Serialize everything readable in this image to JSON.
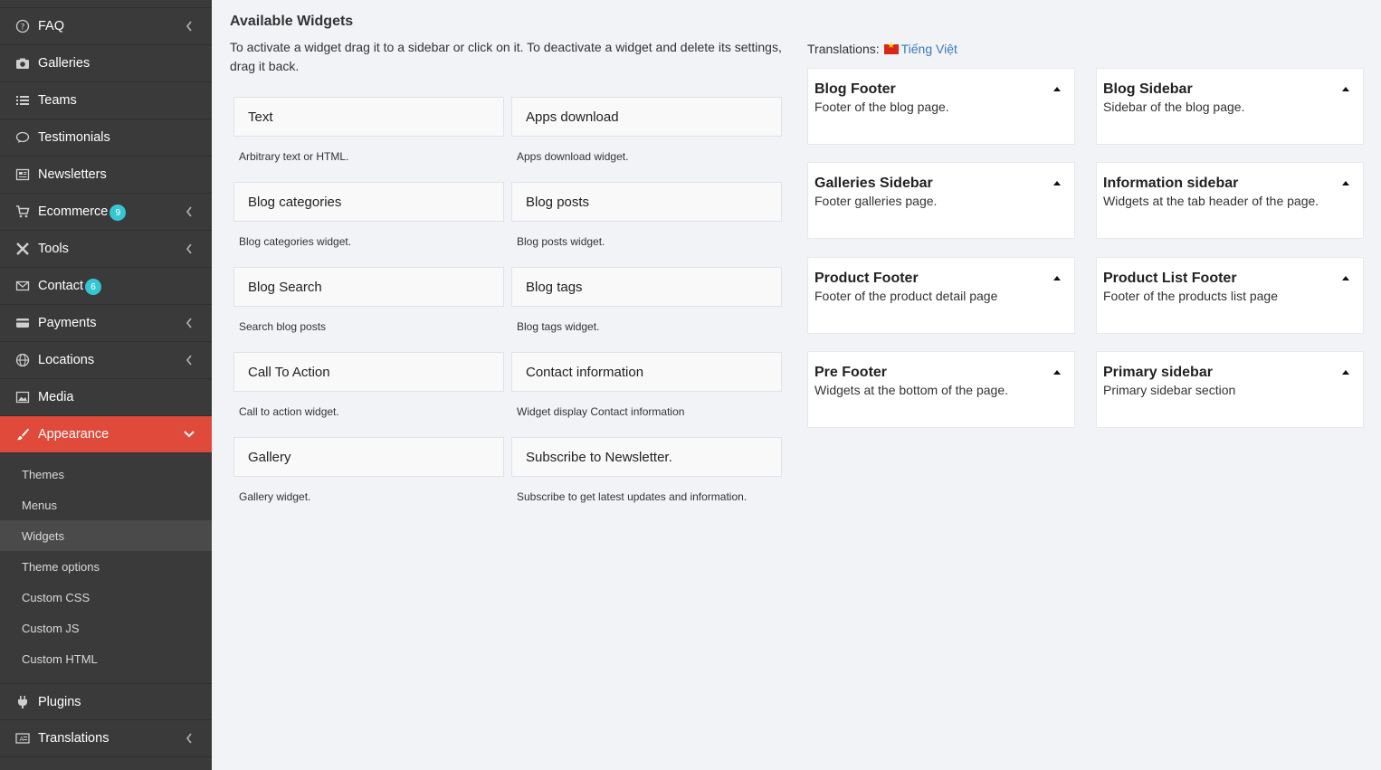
{
  "menu": {
    "top": [
      {
        "label": "FAQ",
        "icon": "question-circle-icon",
        "chevron": true
      },
      {
        "label": "Galleries",
        "icon": "camera-icon"
      },
      {
        "label": "Teams",
        "icon": "list-icon"
      },
      {
        "label": "Testimonials",
        "icon": "comment-icon"
      },
      {
        "label": "Newsletters",
        "icon": "newspaper-icon"
      },
      {
        "label": "Ecommerce",
        "icon": "cart-icon",
        "badge": "9",
        "chevron": true
      },
      {
        "label": "Tools",
        "icon": "tools-icon",
        "chevron": true
      },
      {
        "label": "Contact",
        "icon": "envelope-icon",
        "badge": "6"
      },
      {
        "label": "Payments",
        "icon": "credit-card-icon",
        "chevron": true
      },
      {
        "label": "Locations",
        "icon": "globe-icon",
        "chevron": true
      },
      {
        "label": "Media",
        "icon": "image-icon"
      }
    ],
    "active": {
      "label": "Appearance",
      "icon": "brush-icon"
    },
    "sub": [
      "Themes",
      "Menus",
      "Widgets",
      "Theme options",
      "Custom CSS",
      "Custom JS",
      "Custom HTML"
    ],
    "bottom": [
      {
        "label": "Plugins",
        "icon": "plug-icon"
      },
      {
        "label": "Translations",
        "icon": "language-icon",
        "chevron": true
      }
    ],
    "colors": {
      "background": "#3a3a3a",
      "active": "#e04a3a",
      "badge": "#36c6d3"
    }
  },
  "available": {
    "title": "Available Widgets",
    "description": "To activate a widget drag it to a sidebar or click on it. To deactivate a widget and delete its settings, drag it back.",
    "widgets": [
      {
        "name": "Text",
        "desc": "Arbitrary text or HTML."
      },
      {
        "name": "Apps download",
        "desc": "Apps download widget."
      },
      {
        "name": "Blog categories",
        "desc": "Blog categories widget."
      },
      {
        "name": "Blog posts",
        "desc": "Blog posts widget."
      },
      {
        "name": "Blog Search",
        "desc": "Search blog posts"
      },
      {
        "name": "Blog tags",
        "desc": "Blog tags widget."
      },
      {
        "name": "Call To Action",
        "desc": "Call to action widget."
      },
      {
        "name": "Contact information",
        "desc": "Widget display Contact information"
      },
      {
        "name": "Gallery",
        "desc": "Gallery widget."
      },
      {
        "name": "Subscribe to Newsletter.",
        "desc": "Subscribe to get latest updates and information."
      }
    ]
  },
  "translations": {
    "label": "Translations:",
    "language": "Tiếng Việt"
  },
  "sidebars": [
    {
      "name": "Blog Footer",
      "desc": "Footer of the blog page."
    },
    {
      "name": "Blog Sidebar",
      "desc": "Sidebar of the blog page."
    },
    {
      "name": "Galleries Sidebar",
      "desc": "Footer galleries page."
    },
    {
      "name": "Information sidebar",
      "desc": "Widgets at the tab header of the page."
    },
    {
      "name": "Product Footer",
      "desc": "Footer of the product detail page"
    },
    {
      "name": "Product List Footer",
      "desc": "Footer of the products list page"
    },
    {
      "name": "Pre Footer",
      "desc": "Widgets at the bottom of the page."
    },
    {
      "name": "Primary sidebar",
      "desc": "Primary sidebar section"
    }
  ]
}
